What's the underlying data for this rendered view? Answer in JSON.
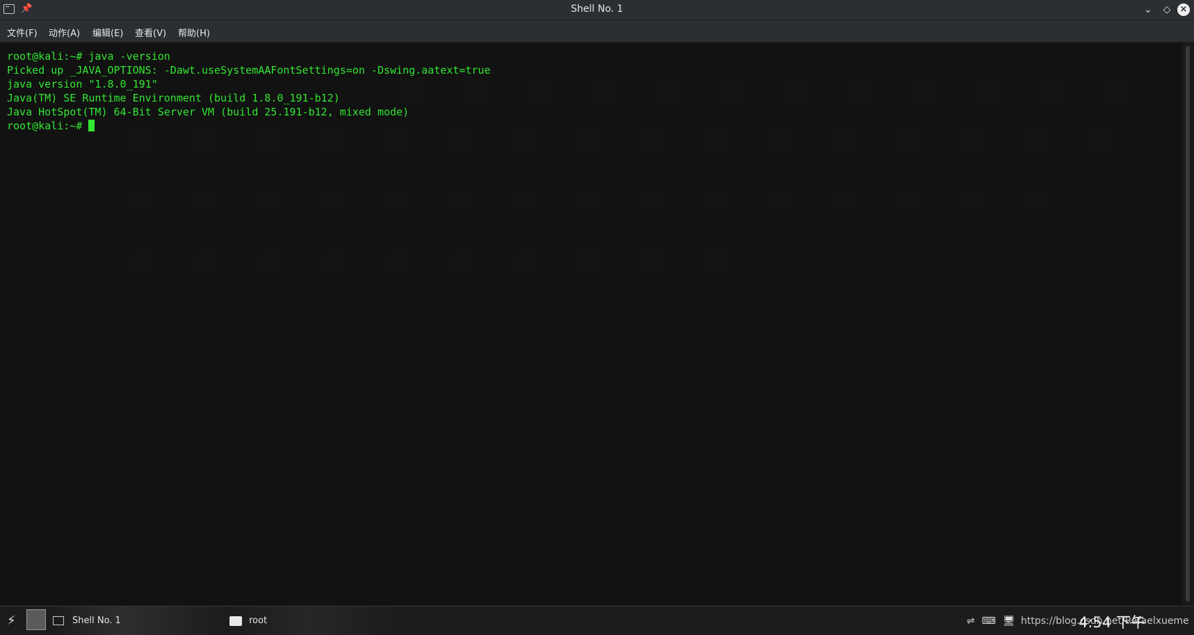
{
  "window": {
    "title": "Shell No. 1"
  },
  "menu": {
    "items": [
      "文件(F)",
      "动作(A)",
      "编辑(E)",
      "查看(V)",
      "帮助(H)"
    ]
  },
  "terminal": {
    "lines": [
      "root@kali:~# java -version",
      "Picked up _JAVA_OPTIONS: -Dawt.useSystemAAFontSettings=on -Dswing.aatext=true",
      "java version \"1.8.0_191\"",
      "Java(TM) SE Runtime Environment (build 1.8.0_191-b12)",
      "Java HotSpot(TM) 64-Bit Server VM (build 25.191-b12, mixed mode)"
    ],
    "prompt": "root@kali:~# ",
    "text_color": "#32e632"
  },
  "taskbar": {
    "tasks": [
      {
        "label": "Shell No. 1"
      },
      {
        "label": "root"
      }
    ],
    "clock": "4:54 下午",
    "watermark": "https://blog.csdn.net/Rafaelxueme"
  }
}
